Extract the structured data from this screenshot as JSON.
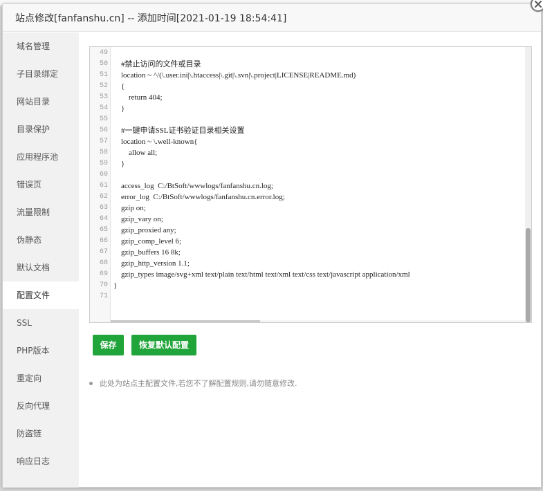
{
  "modal": {
    "title": "站点修改[fanfanshu.cn] -- 添加时间[2021-01-19 18:54:41]"
  },
  "sidebar": {
    "items": [
      {
        "label": "域名管理",
        "active": false
      },
      {
        "label": "子目录绑定",
        "active": false
      },
      {
        "label": "网站目录",
        "active": false
      },
      {
        "label": "目录保护",
        "active": false
      },
      {
        "label": "应用程序池",
        "active": false
      },
      {
        "label": "错误页",
        "active": false
      },
      {
        "label": "流量限制",
        "active": false
      },
      {
        "label": "伪静态",
        "active": false
      },
      {
        "label": "默认文档",
        "active": false
      },
      {
        "label": "配置文件",
        "active": true
      },
      {
        "label": "SSL",
        "active": false
      },
      {
        "label": "PHP版本",
        "active": false
      },
      {
        "label": "重定向",
        "active": false
      },
      {
        "label": "反向代理",
        "active": false
      },
      {
        "label": "防盗链",
        "active": false
      },
      {
        "label": "响应日志",
        "active": false
      }
    ]
  },
  "editor": {
    "lines": [
      {
        "num": "49",
        "text": ""
      },
      {
        "num": "50",
        "text": "    #禁止访问的文件或目录"
      },
      {
        "num": "51",
        "text": "    location ~ ^/(\\.user.ini|\\.htaccess|\\.git|\\.svn|\\.project|LICENSE|README.md)"
      },
      {
        "num": "52",
        "text": "    {"
      },
      {
        "num": "53",
        "text": "        return 404;"
      },
      {
        "num": "54",
        "text": "    }"
      },
      {
        "num": "55",
        "text": ""
      },
      {
        "num": "56",
        "text": "    #一键申请SSL证书验证目录相关设置"
      },
      {
        "num": "57",
        "text": "    location ~ \\.well-known{"
      },
      {
        "num": "58",
        "text": "        allow all;"
      },
      {
        "num": "59",
        "text": "    }"
      },
      {
        "num": "60",
        "text": ""
      },
      {
        "num": "61",
        "text": "    access_log  C:/BtSoft/wwwlogs/fanfanshu.cn.log;"
      },
      {
        "num": "62",
        "text": "    error_log  C:/BtSoft/wwwlogs/fanfanshu.cn.error.log;"
      },
      {
        "num": "63",
        "text": "    gzip on;"
      },
      {
        "num": "64",
        "text": "    gzip_vary on;"
      },
      {
        "num": "65",
        "text": "    gzip_proxied any;"
      },
      {
        "num": "66",
        "text": "    gzip_comp_level 6;"
      },
      {
        "num": "67",
        "text": "    gzip_buffers 16 8k;"
      },
      {
        "num": "68",
        "text": "    gzip_http_version 1.1;"
      },
      {
        "num": "69",
        "text": "    gzip_types image/svg+xml text/plain text/html text/xml text/css text/javascript application/xml"
      },
      {
        "num": "70",
        "text": "}"
      },
      {
        "num": "71",
        "text": ""
      }
    ]
  },
  "buttons": {
    "save_label": "保存",
    "reset_label": "恢复默认配置"
  },
  "tips": {
    "text": "此处为站点主配置文件,若您不了解配置规则,请勿随意修改."
  },
  "colors": {
    "accent": "#20a53a",
    "sidebar_bg": "#f1f1f1"
  },
  "icons": {
    "close": "close-icon"
  }
}
